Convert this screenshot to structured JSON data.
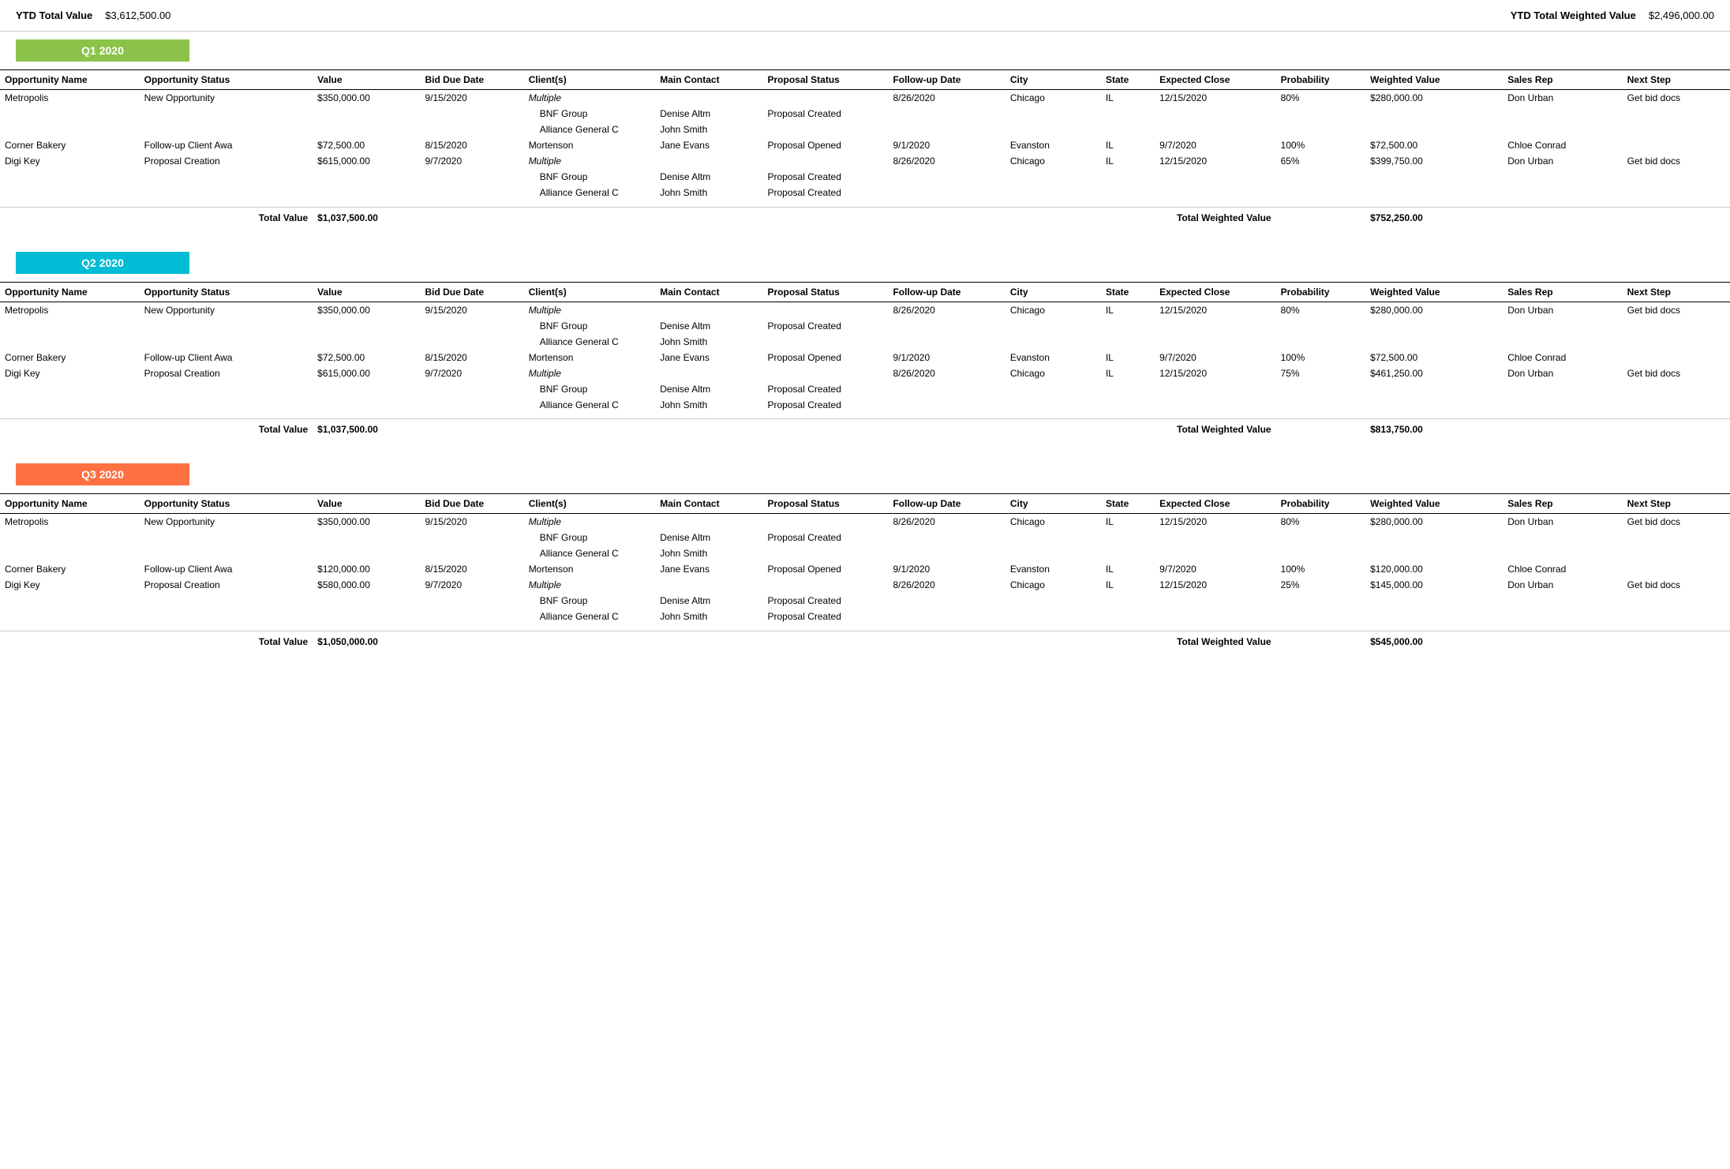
{
  "topBar": {
    "ytdLabel": "YTD Total Value",
    "ytdValue": "$3,612,500.00",
    "ytdWeightedLabel": "YTD Total Weighted Value",
    "ytdWeightedValue": "$2,496,000.00"
  },
  "columns": {
    "opportunityName": "Opportunity Name",
    "opportunityStatus": "Opportunity Status",
    "value": "Value",
    "bidDueDate": "Bid Due Date",
    "clients": "Client(s)",
    "mainContact": "Main Contact",
    "proposalStatus": "Proposal Status",
    "followupDate": "Follow-up Date",
    "city": "City",
    "state": "State",
    "expectedClose": "Expected Close",
    "probability": "Probability",
    "weightedValue": "Weighted Value",
    "salesRep": "Sales Rep",
    "nextStep": "Next Step"
  },
  "quarters": [
    {
      "id": "q1",
      "label": "Q1 2020",
      "colorClass": "q1",
      "totalValue": "$1,037,500.00",
      "totalWeightedValue": "$752,250.00",
      "rows": [
        {
          "name": "Metropolis",
          "status": "New Opportunity",
          "value": "$350,000.00",
          "bidDate": "9/15/2020",
          "client": "Multiple",
          "clientIsItalic": true,
          "contact": "",
          "proposalStatus": "",
          "followup": "8/26/2020",
          "city": "Chicago",
          "state": "IL",
          "expectedClose": "12/15/2020",
          "probability": "80%",
          "weightedValue": "$280,000.00",
          "salesRep": "Don Urban",
          "nextStep": "Get bid docs",
          "subRows": [
            {
              "client": "BNF Group",
              "contact": "Denise Altm",
              "proposalStatus": "Proposal Created"
            },
            {
              "client": "Alliance General C",
              "contact": "John Smith",
              "proposalStatus": ""
            }
          ]
        },
        {
          "name": "Corner Bakery",
          "status": "Follow-up Client Awa",
          "value": "$72,500.00",
          "bidDate": "8/15/2020",
          "client": "Mortenson",
          "clientIsItalic": false,
          "contact": "Jane Evans",
          "proposalStatus": "Proposal Opened",
          "followup": "9/1/2020",
          "city": "Evanston",
          "state": "IL",
          "expectedClose": "9/7/2020",
          "probability": "100%",
          "weightedValue": "$72,500.00",
          "salesRep": "Chloe Conrad",
          "nextStep": "",
          "subRows": []
        },
        {
          "name": "Digi Key",
          "status": "Proposal Creation",
          "value": "$615,000.00",
          "bidDate": "9/7/2020",
          "client": "Multiple",
          "clientIsItalic": true,
          "contact": "",
          "proposalStatus": "",
          "followup": "8/26/2020",
          "city": "Chicago",
          "state": "IL",
          "expectedClose": "12/15/2020",
          "probability": "65%",
          "weightedValue": "$399,750.00",
          "salesRep": "Don Urban",
          "nextStep": "Get bid docs",
          "subRows": [
            {
              "client": "BNF Group",
              "contact": "Denise Altm",
              "proposalStatus": "Proposal Created"
            },
            {
              "client": "Alliance General C",
              "contact": "John Smith",
              "proposalStatus": "Proposal Created"
            }
          ]
        }
      ]
    },
    {
      "id": "q2",
      "label": "Q2 2020",
      "colorClass": "q2",
      "totalValue": "$1,037,500.00",
      "totalWeightedValue": "$813,750.00",
      "rows": [
        {
          "name": "Metropolis",
          "status": "New Opportunity",
          "value": "$350,000.00",
          "bidDate": "9/15/2020",
          "client": "Multiple",
          "clientIsItalic": true,
          "contact": "",
          "proposalStatus": "",
          "followup": "8/26/2020",
          "city": "Chicago",
          "state": "IL",
          "expectedClose": "12/15/2020",
          "probability": "80%",
          "weightedValue": "$280,000.00",
          "salesRep": "Don Urban",
          "nextStep": "Get bid docs",
          "subRows": [
            {
              "client": "BNF Group",
              "contact": "Denise Altm",
              "proposalStatus": "Proposal Created"
            },
            {
              "client": "Alliance General C",
              "contact": "John Smith",
              "proposalStatus": ""
            }
          ]
        },
        {
          "name": "Corner Bakery",
          "status": "Follow-up Client Awa",
          "value": "$72,500.00",
          "bidDate": "8/15/2020",
          "client": "Mortenson",
          "clientIsItalic": false,
          "contact": "Jane Evans",
          "proposalStatus": "Proposal Opened",
          "followup": "9/1/2020",
          "city": "Evanston",
          "state": "IL",
          "expectedClose": "9/7/2020",
          "probability": "100%",
          "weightedValue": "$72,500.00",
          "salesRep": "Chloe Conrad",
          "nextStep": "",
          "subRows": []
        },
        {
          "name": "Digi Key",
          "status": "Proposal Creation",
          "value": "$615,000.00",
          "bidDate": "9/7/2020",
          "client": "Multiple",
          "clientIsItalic": true,
          "contact": "",
          "proposalStatus": "",
          "followup": "8/26/2020",
          "city": "Chicago",
          "state": "IL",
          "expectedClose": "12/15/2020",
          "probability": "75%",
          "weightedValue": "$461,250.00",
          "salesRep": "Don Urban",
          "nextStep": "Get bid docs",
          "subRows": [
            {
              "client": "BNF Group",
              "contact": "Denise Altm",
              "proposalStatus": "Proposal Created"
            },
            {
              "client": "Alliance General C",
              "contact": "John Smith",
              "proposalStatus": "Proposal Created"
            }
          ]
        }
      ]
    },
    {
      "id": "q3",
      "label": "Q3 2020",
      "colorClass": "q3",
      "totalValue": "$1,050,000.00",
      "totalWeightedValue": "$545,000.00",
      "rows": [
        {
          "name": "Metropolis",
          "status": "New Opportunity",
          "value": "$350,000.00",
          "bidDate": "9/15/2020",
          "client": "Multiple",
          "clientIsItalic": true,
          "contact": "",
          "proposalStatus": "",
          "followup": "8/26/2020",
          "city": "Chicago",
          "state": "IL",
          "expectedClose": "12/15/2020",
          "probability": "80%",
          "weightedValue": "$280,000.00",
          "salesRep": "Don Urban",
          "nextStep": "Get bid docs",
          "subRows": [
            {
              "client": "BNF Group",
              "contact": "Denise Altm",
              "proposalStatus": "Proposal Created"
            },
            {
              "client": "Alliance General C",
              "contact": "John Smith",
              "proposalStatus": ""
            }
          ]
        },
        {
          "name": "Corner Bakery",
          "status": "Follow-up Client Awa",
          "value": "$120,000.00",
          "bidDate": "8/15/2020",
          "client": "Mortenson",
          "clientIsItalic": false,
          "contact": "Jane Evans",
          "proposalStatus": "Proposal Opened",
          "followup": "9/1/2020",
          "city": "Evanston",
          "state": "IL",
          "expectedClose": "9/7/2020",
          "probability": "100%",
          "weightedValue": "$120,000.00",
          "salesRep": "Chloe Conrad",
          "nextStep": "",
          "subRows": []
        },
        {
          "name": "Digi Key",
          "status": "Proposal Creation",
          "value": "$580,000.00",
          "bidDate": "9/7/2020",
          "client": "Multiple",
          "clientIsItalic": true,
          "contact": "",
          "proposalStatus": "",
          "followup": "8/26/2020",
          "city": "Chicago",
          "state": "IL",
          "expectedClose": "12/15/2020",
          "probability": "25%",
          "weightedValue": "$145,000.00",
          "salesRep": "Don Urban",
          "nextStep": "Get bid docs",
          "subRows": [
            {
              "client": "BNF Group",
              "contact": "Denise Altm",
              "proposalStatus": "Proposal Created"
            },
            {
              "client": "Alliance General C",
              "contact": "John Smith",
              "proposalStatus": "Proposal Created"
            }
          ]
        }
      ]
    }
  ]
}
